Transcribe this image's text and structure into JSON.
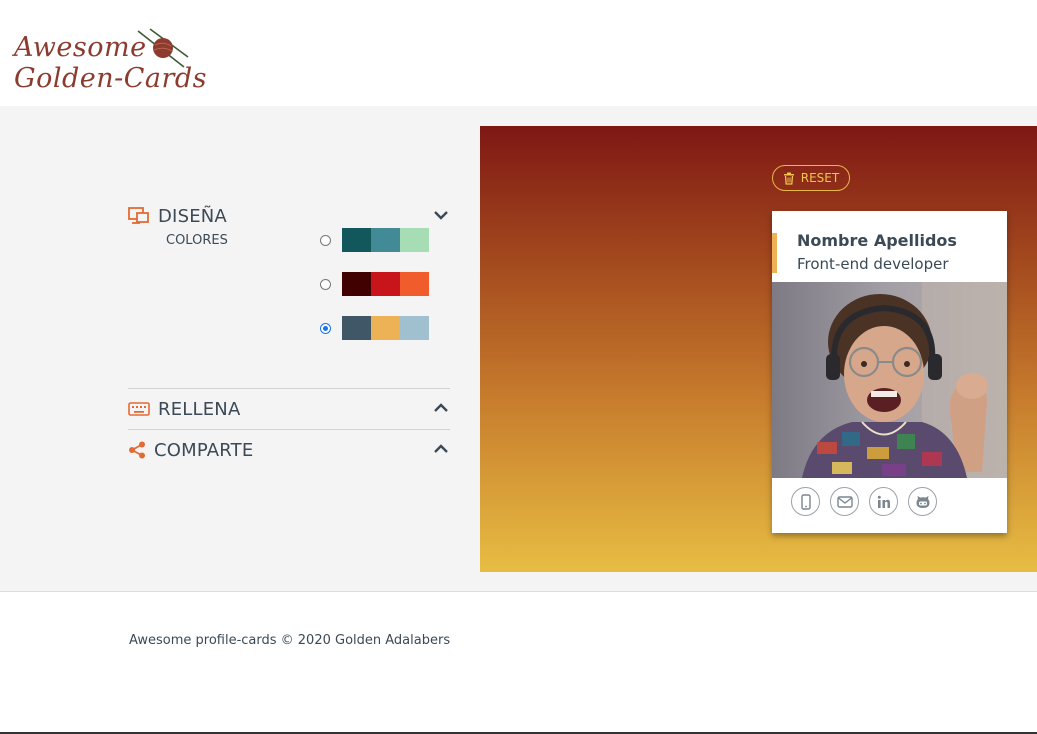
{
  "logo": {
    "line1": "Awesome",
    "line2": "Golden-Cards"
  },
  "colors": {
    "accent": "#e26b34",
    "title": "#3b4a56",
    "reset": "#f0c64e"
  },
  "design": {
    "title": "DISEÑA",
    "icon": "design-icon",
    "colors_label": "COLORES",
    "palettes": [
      {
        "selected": false,
        "swatches": [
          "#11575b",
          "#428a96",
          "#a6ddb5"
        ]
      },
      {
        "selected": false,
        "swatches": [
          "#420101",
          "#c8141b",
          "#f05c2b"
        ]
      },
      {
        "selected": true,
        "swatches": [
          "#3f5767",
          "#eeb256",
          "#a0c0cf"
        ]
      }
    ]
  },
  "fill": {
    "title": "RELLENA",
    "icon": "keyboard-icon"
  },
  "share": {
    "title": "COMPARTE",
    "icon": "share-icon"
  },
  "preview": {
    "reset_label": "RESET",
    "card": {
      "name": "Nombre Apellidos",
      "job": "Front-end developer",
      "social": [
        "phone-icon",
        "mail-icon",
        "linkedin-icon",
        "github-icon"
      ]
    }
  },
  "footer": {
    "text": "Awesome profile-cards © 2020 Golden Adalabers"
  }
}
